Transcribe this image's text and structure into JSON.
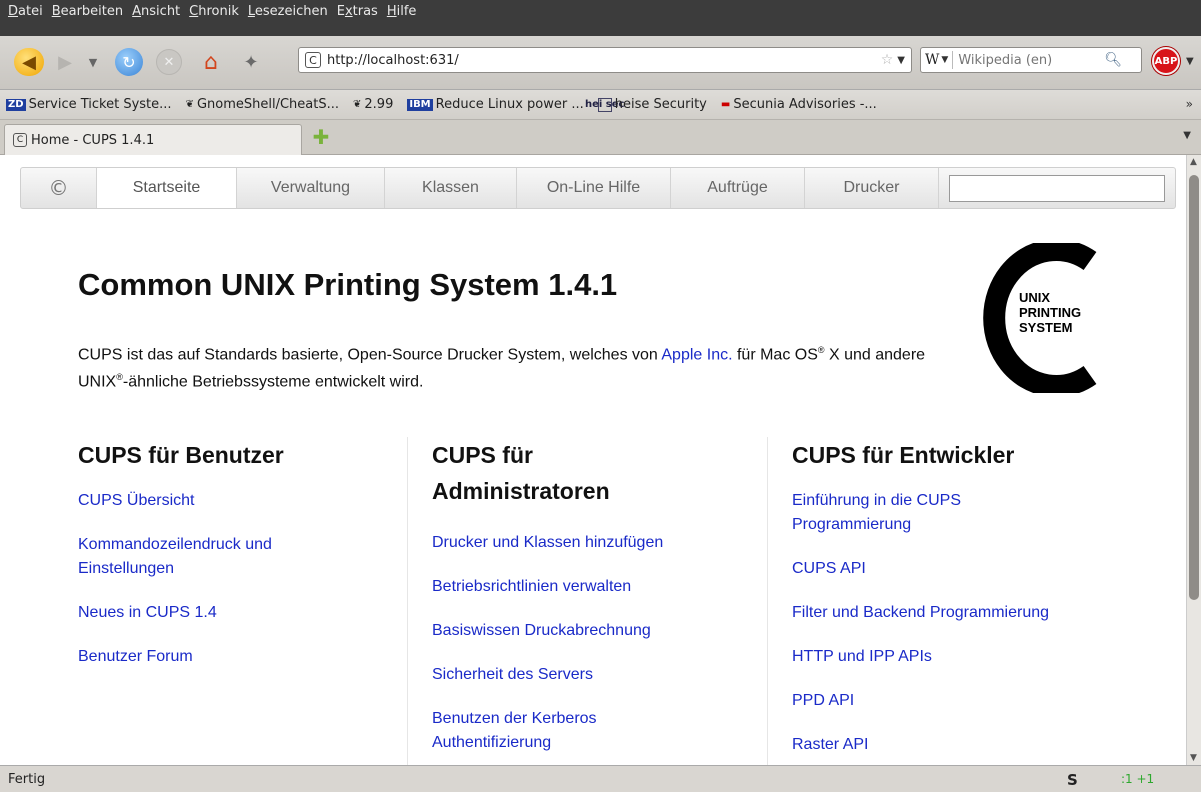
{
  "menubar": {
    "items": [
      {
        "u": "D",
        "rest": "atei"
      },
      {
        "u": "B",
        "rest": "earbeiten"
      },
      {
        "u": "A",
        "rest": "nsicht"
      },
      {
        "u": "C",
        "rest": "hronik"
      },
      {
        "u": "L",
        "rest": "esezeichen"
      },
      {
        "pre": "E",
        "u": "x",
        "rest": "tras"
      },
      {
        "u": "H",
        "rest": "ilfe"
      }
    ]
  },
  "navbar": {
    "url": "http://localhost:631/",
    "search_engine": "W",
    "search_placeholder": "Wikipedia (en)",
    "abp_label": "ABP"
  },
  "bookmarks": [
    {
      "icon": "ZD",
      "label": "Service Ticket Syste..."
    },
    {
      "icon": "❦",
      "label": "GnomeShell/CheatS..."
    },
    {
      "icon": "❦",
      "label": "2.99"
    },
    {
      "icon": "IBM",
      "label": "Reduce Linux power ..."
    },
    {
      "icon": "hei sec",
      "label": "heise Security"
    },
    {
      "icon": "▬",
      "label": "Secunia Advisories -..."
    }
  ],
  "tabs": {
    "active_title": "Home - CUPS 1.4.1"
  },
  "cups_nav": {
    "tabs": [
      "Startseite",
      "Verwaltung",
      "Klassen",
      "On-Line Hilfe",
      "Auftrüge",
      "Drucker"
    ],
    "active": "Startseite"
  },
  "main": {
    "title": "Common UNIX Printing System 1.4.1",
    "intro_1": "CUPS ist das auf Standards basierte, Open-Source Drucker System, welches von ",
    "intro_link": "Apple Inc.",
    "intro_2": " für Mac OS",
    "intro_sup1": "®",
    "intro_3": " X und andere UNIX",
    "intro_sup2": "®",
    "intro_4": "-ähnliche Betriebssysteme entwickelt wird.",
    "logo_lines": [
      "UNIX",
      "PRINTING",
      "SYSTEM"
    ]
  },
  "columns": [
    {
      "heading": "CUPS für Benutzer",
      "links": [
        "CUPS Übersicht",
        "Kommandozeilendruck und Einstellungen",
        "Neues in CUPS 1.4",
        "Benutzer Forum"
      ]
    },
    {
      "heading": "CUPS für Administratoren",
      "links": [
        "Drucker und Klassen hinzufügen",
        "Betriebsrichtlinien verwalten",
        "Basiswissen Druckabrechnung",
        "Sicherheit des Servers",
        "Benutzen der Kerberos Authentifizierung"
      ]
    },
    {
      "heading": "CUPS für Entwickler",
      "links": [
        "Einführung in die CUPS Programmierung",
        "CUPS API",
        "Filter und Backend Programmierung",
        "HTTP und IPP APIs",
        "PPD API",
        "Raster API"
      ]
    }
  ],
  "statusbar": {
    "text": "Fertig",
    "s_icon": "S",
    "counter": ":1 +1"
  }
}
